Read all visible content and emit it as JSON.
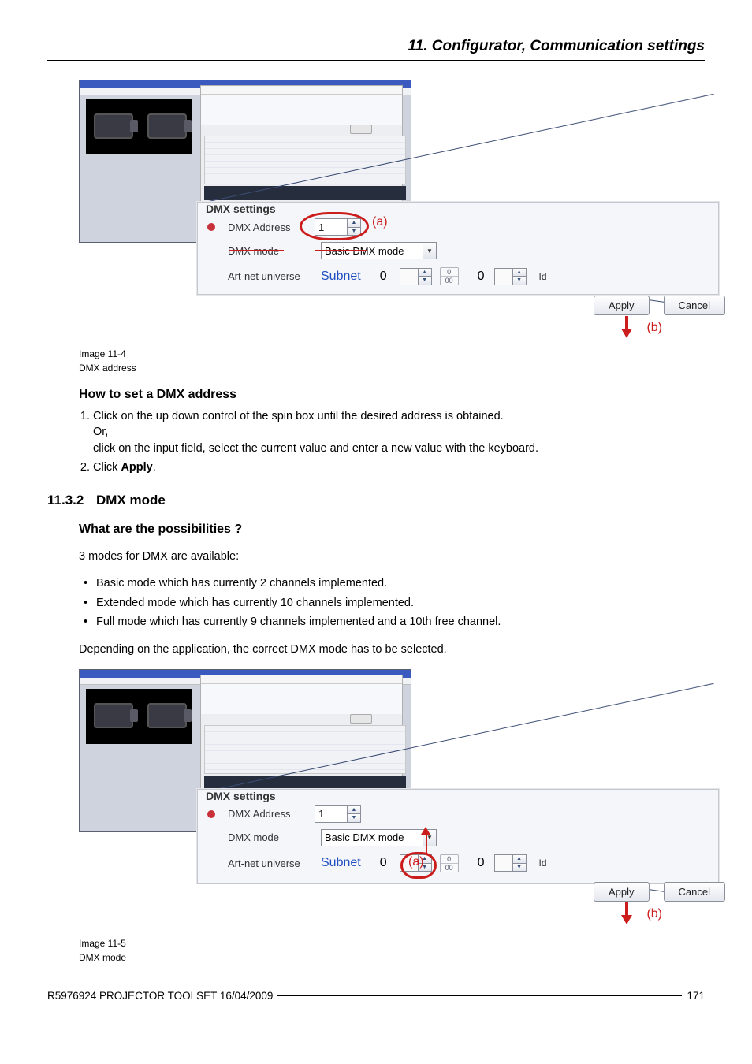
{
  "chapter_title": "11.  Configurator, Communication settings",
  "fig1": {
    "section_title": "DMX settings",
    "dmx_addr_label": "DMX Address",
    "dmx_addr_value": "1",
    "dmx_mode_label": "DMX mode",
    "dmx_mode_value": "Basic DMX mode",
    "artnet_label": "Art-net universe",
    "artnet_subnet": "Subnet",
    "artnet_subnet_value": "0",
    "artnet_pair_top": "0",
    "artnet_pair_bot": "00",
    "artnet_id_value": "0",
    "artnet_id_label": "Id",
    "apply": "Apply",
    "cancel": "Cancel",
    "callout_a": "(a)",
    "callout_b": "(b)",
    "caption_num": "Image 11-4",
    "caption_txt": "DMX address"
  },
  "howtoset_heading": "How to set a DMX address",
  "howtoset_step1_a": "Click on the up down control of the spin box until the desired address is obtained.",
  "howtoset_step1_or": "Or,",
  "howtoset_step1_b": "click on the input field, select the current value and enter a new value with the keyboard.",
  "howtoset_step2_a": "Click ",
  "howtoset_step2_b": "Apply",
  "howtoset_step2_c": ".",
  "sec_num": "11.3.2",
  "sec_title": "DMX mode",
  "poss_heading": "What are the possibilities ?",
  "poss_intro": "3 modes for DMX are available:",
  "poss_b1": "Basic mode which has currently 2 channels implemented.",
  "poss_b2": "Extended mode which has currently 10 channels implemented.",
  "poss_b3": "Full mode which has currently 9 channels implemented and a 10th free channel.",
  "poss_end": "Depending on the application, the correct DMX mode has to be selected.",
  "fig2": {
    "section_title": "DMX settings",
    "dmx_addr_label": "DMX Address",
    "dmx_addr_value": "1",
    "dmx_mode_label": "DMX mode",
    "dmx_mode_value": "Basic DMX mode",
    "artnet_label": "Art-net universe",
    "artnet_subnet": "Subnet",
    "artnet_subnet_value": "0",
    "artnet_pair_top": "0",
    "artnet_pair_bot": "00",
    "artnet_id_value": "0",
    "artnet_id_label": "Id",
    "apply": "Apply",
    "cancel": "Cancel",
    "callout_a": "(a)",
    "callout_b": "(b)",
    "caption_num": "Image 11-5",
    "caption_txt": "DMX mode"
  },
  "footer_left": "R5976924   PROJECTOR TOOLSET  16/04/2009",
  "footer_page": "171"
}
